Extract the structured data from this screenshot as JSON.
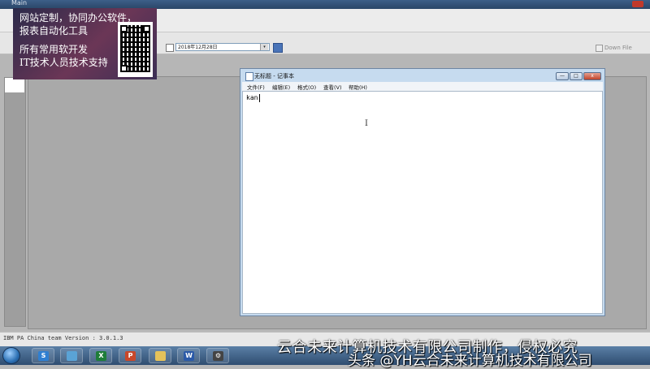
{
  "app": {
    "title": "Main",
    "toolbar": {
      "date_value": "2018年12月28日",
      "date_drop": "▾",
      "down_file_label": "Down File"
    },
    "status_text": "IBM PA China  team Version : 3.0.1.3"
  },
  "ad": {
    "lines": [
      "网站定制，协同办公软件，",
      "报表自动化工具",
      "所有常用软开发",
      "IT技术人员技术支持"
    ]
  },
  "notepad": {
    "title": "无标题 - 记事本",
    "menu": [
      "文件(F)",
      "编辑(E)",
      "格式(O)",
      "查看(V)",
      "帮助(H)"
    ],
    "content": "kan",
    "buttons": {
      "minimize": "—",
      "maximize": "□",
      "close": "x"
    }
  },
  "watermark": {
    "company": "云合未来计算机技术有限公司制作，侵权必究",
    "source": "头条 @YH云合未来计算机技术有限公司"
  },
  "taskbar": {
    "apps": [
      {
        "name": "sogou",
        "glyph": "S",
        "color": "#2f7fd1"
      },
      {
        "name": "explorer",
        "glyph": "",
        "color": "#5aa3d6"
      },
      {
        "name": "excel",
        "glyph": "X",
        "color": "#1e7d3a"
      },
      {
        "name": "powerpoint",
        "glyph": "P",
        "color": "#c8472a"
      },
      {
        "name": "folder",
        "glyph": "",
        "color": "#e5c25a"
      },
      {
        "name": "word",
        "glyph": "W",
        "color": "#2b5aa8"
      },
      {
        "name": "settings",
        "glyph": "⚙",
        "color": "#444444"
      }
    ]
  }
}
